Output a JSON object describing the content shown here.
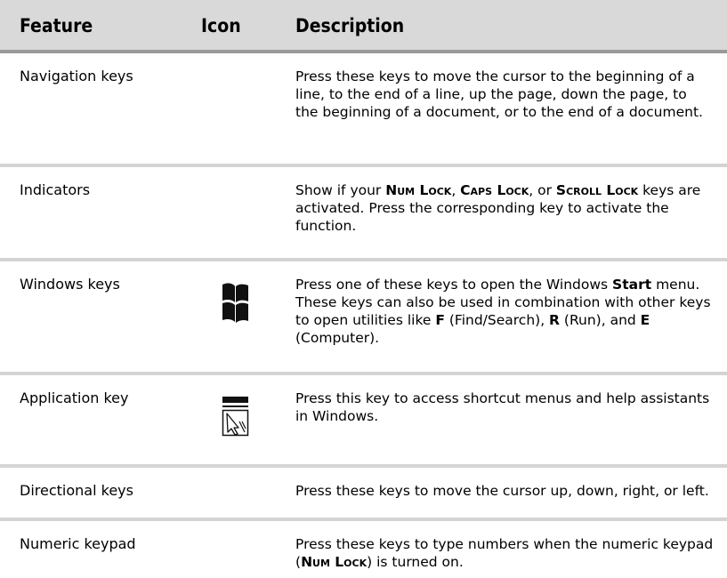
{
  "header": {
    "feature": "Feature",
    "icon": "Icon",
    "description": "Description"
  },
  "rows": [
    {
      "feature": "Navigation keys",
      "icon": "",
      "description": "Press these keys to move the cursor to the beginning of a line, to the end of a line, up the page, down the page, to the beginning of a document, or to the end of a document."
    },
    {
      "feature": "Indicators",
      "icon": "",
      "description": {
        "t1": "Show if your ",
        "k1": "Num Lock",
        "t2": ", ",
        "k2": "Caps Lock",
        "t3": ", or ",
        "k3": "Scroll Lock",
        "t4": " keys are activated. Press the corresponding key to activate the function."
      }
    },
    {
      "feature": "Windows keys",
      "icon": "windows-logo-icon",
      "description": {
        "t1": "Press one of these keys to open the Windows ",
        "b1": "Start",
        "t2": " menu. These keys can also be used in combination with other keys to open utilities like ",
        "b2": "F",
        "t3": " (Find/Search), ",
        "b3": "R",
        "t4": " (Run), and ",
        "b4": "E",
        "t5": " (Computer)."
      }
    },
    {
      "feature": "Application key",
      "icon": "menu-cursor-icon",
      "description": "Press this key to access shortcut menus and help assistants in Windows."
    },
    {
      "feature": "Directional keys",
      "icon": "",
      "description": "Press these keys to move the cursor up, down, right, or left."
    },
    {
      "feature": "Numeric keypad",
      "icon": "",
      "description": {
        "t1": "Press these keys to type numbers when the numeric keypad (",
        "k1": "Num Lock",
        "t2": ") is turned on."
      }
    }
  ]
}
